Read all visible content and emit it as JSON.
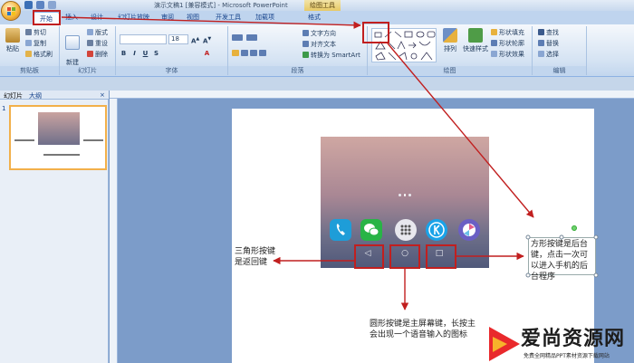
{
  "window": {
    "title": "演示文稿1 [兼容模式] - Microsoft PowerPoint",
    "contextual_tools": "绘图工具"
  },
  "tabs": [
    "开始",
    "插入",
    "设计",
    "幻灯片放映",
    "审阅",
    "视图",
    "开发工具",
    "加载项",
    "格式"
  ],
  "ribbon": {
    "clipboard": {
      "paste": "粘贴",
      "cut": "剪切",
      "copy": "复制",
      "format_painter": "格式刷",
      "label": "剪贴板"
    },
    "slides": {
      "new_slide": "新建\n幻灯片",
      "layout": "版式",
      "reset": "重设",
      "delete": "删除",
      "label": "幻灯片"
    },
    "font": {
      "size": "18",
      "label": "字体",
      "bold": "B",
      "italic": "I",
      "underline": "U",
      "strike": "S"
    },
    "paragraph": {
      "text_direction": "文字方向",
      "align_text": "对齐文本",
      "smartart": "转换为 SmartArt",
      "label": "段落"
    },
    "drawing": {
      "arrange": "排列",
      "quick_styles": "快速样式",
      "shape_fill": "形状填充",
      "shape_outline": "形状轮廓",
      "shape_effects": "形状效果",
      "label": "绘图"
    },
    "editing": {
      "find": "查找",
      "replace": "替换",
      "select": "选择",
      "label": "编辑"
    }
  },
  "panel": {
    "tab_slides": "幻灯片",
    "tab_outline": "大纲",
    "slide_number": "1"
  },
  "annotations": {
    "left": "三角形按键\n是返回键",
    "right": "方形按键是后台键，点击一次可以进入手机的后台程序",
    "bottom": "圆形按键是主屏幕键，长按主\n会出现一个语音输入的图标"
  },
  "nav_glyphs": {
    "back": "◁",
    "home": "○",
    "recent": "□"
  },
  "watermark": {
    "title": "爱尚资源网",
    "subtitle": "免费全网精品PPT素材资源下载网站"
  },
  "colors": {
    "accent_red": "#c11f1f",
    "ribbon_blue": "#15428b",
    "slide_bg": "#7c9cc9"
  }
}
